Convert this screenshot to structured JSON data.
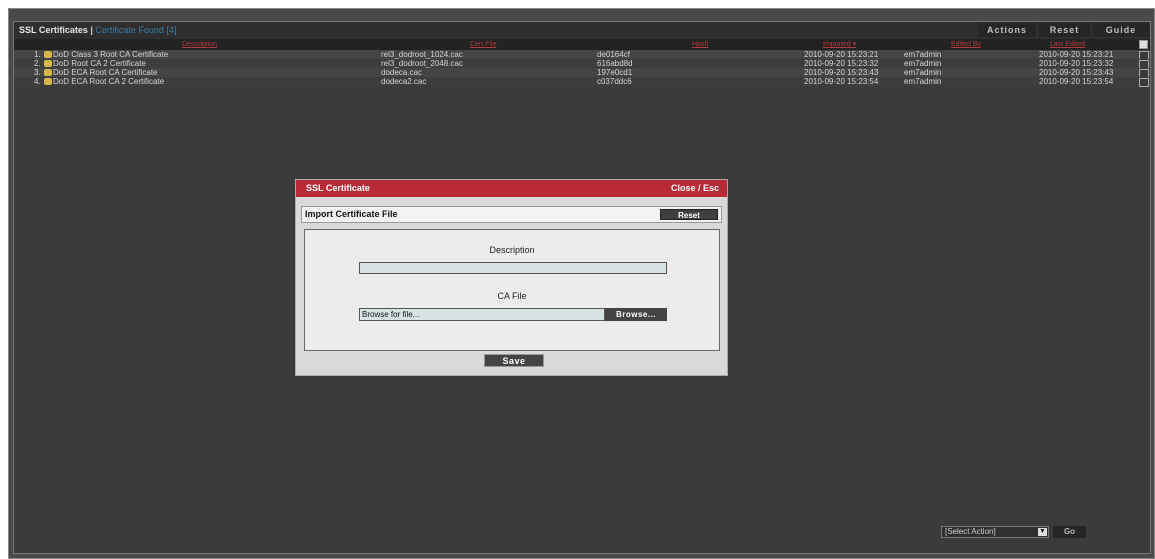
{
  "title": "SSL Certificates",
  "title_sep": " | ",
  "found_text": "Certificate Found [4]",
  "toolbar": {
    "actions_label": "Actions",
    "reset_label": "Reset",
    "guide_label": "Guide"
  },
  "columns": {
    "description": "Description",
    "cert_file": "Cert File",
    "hash": "Hash",
    "imported": "Imported ▾",
    "edited_by": "Edited By",
    "last_edited": "Last Edited"
  },
  "rows": [
    {
      "num": "1.",
      "description": "DoD Class 3 Root CA Certificate",
      "cert_file": "rel3_dodroot_1024.cac",
      "hash": "de0164cf",
      "imported": "2010-09-20 15:23:21",
      "edited_by": "em7admin",
      "last_edited": "2010-09-20 15:23:21"
    },
    {
      "num": "2.",
      "description": "DoD Root CA 2 Certificate",
      "cert_file": "rel3_dodroot_2048.cac",
      "hash": "616abd8d",
      "imported": "2010-09-20 15:23:32",
      "edited_by": "em7admin",
      "last_edited": "2010-09-20 15:23:32"
    },
    {
      "num": "3.",
      "description": "DoD ECA Root CA Certificate",
      "cert_file": "dodeca.cac",
      "hash": "197e0cd1",
      "imported": "2010-09-20 15:23:43",
      "edited_by": "em7admin",
      "last_edited": "2010-09-20 15:23:43"
    },
    {
      "num": "4.",
      "description": "DoD ECA Root CA 2 Certificate",
      "cert_file": "dodeca2.cac",
      "hash": "c037ddc6",
      "imported": "2010-09-20 15:23:54",
      "edited_by": "em7admin",
      "last_edited": "2010-09-20 15:23:54"
    }
  ],
  "modal": {
    "title": "SSL Certificate",
    "close_label": "Close / Esc",
    "subtitle": "Import Certificate File",
    "reset_label": "Reset",
    "description_label": "Description",
    "description_value": "",
    "ca_file_label": "CA File",
    "file_placeholder": "Browse for file...",
    "browse_label": "Browse...",
    "save_label": "Save"
  },
  "footer": {
    "select_value": "[Select Action]",
    "go_label": "Go"
  },
  "colors": {
    "modal_header": "#b82a35",
    "found_text": "#3f7aa3",
    "header_link": "#b33b3b"
  }
}
